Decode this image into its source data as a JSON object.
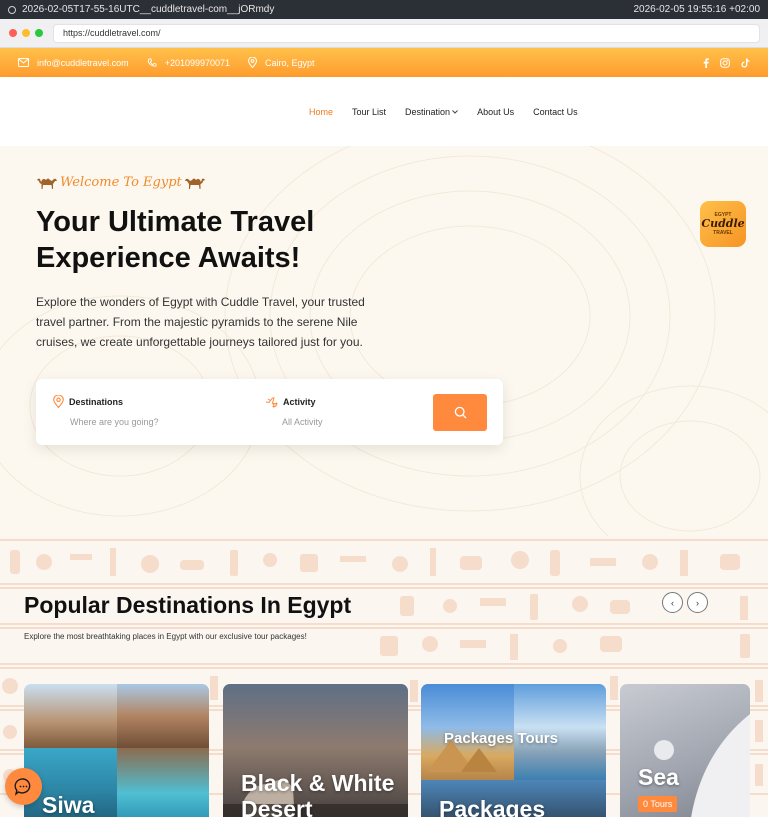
{
  "recording": {
    "filename": "2026-02-05T17-55-16UTC__cuddletravel-com__jORmdy",
    "timestamp": "2026-02-05 19:55:16 +02:00"
  },
  "browser": {
    "url": "https://cuddletravel.com/",
    "traffic_lights": [
      "#ff5f57",
      "#febc2e",
      "#28c840"
    ]
  },
  "topbar": {
    "email": "info@cuddletravel.com",
    "phone": "+201099970071",
    "location": "Cairo, Egypt",
    "socials": [
      "facebook-icon",
      "instagram-icon",
      "tiktok-icon"
    ]
  },
  "nav": {
    "items": [
      {
        "label": "Home",
        "active": true
      },
      {
        "label": "Tour List",
        "active": false
      },
      {
        "label": "Destination",
        "active": false,
        "dropdown": true
      },
      {
        "label": "About Us",
        "active": false
      },
      {
        "label": "Contact Us",
        "active": false
      }
    ]
  },
  "hero": {
    "welcome": "Welcome To Egypt",
    "title": "Your Ultimate Travel Experience Awaits!",
    "description": "Explore the wonders of Egypt with Cuddle Travel, your trusted travel partner. From the majestic pyramids to the serene Nile cruises, we create unforgettable journeys tailored just for you.",
    "search": {
      "destinations_label": "Destinations",
      "destinations_placeholder": "Where are you going?",
      "activity_label": "Activity",
      "activity_placeholder": "All Activity"
    },
    "badge": {
      "line1": "EGYPT",
      "line2": "Cuddle",
      "line3": "TRAVEL"
    }
  },
  "popular": {
    "title": "Popular Destinations In Egypt",
    "subtitle": "Explore the most breathtaking places in Egypt with our exclusive tour packages!",
    "prev_label": "‹",
    "next_label": "›",
    "cards": [
      {
        "title": "Siwa",
        "overlay": ""
      },
      {
        "title": "Black & White Desert",
        "overlay": ""
      },
      {
        "title": "Packages",
        "overlay": "Packages Tours"
      },
      {
        "title": "Sea",
        "overlay": "",
        "tours": "0 Tours"
      }
    ]
  },
  "colors": {
    "accent": "#ff8a3d",
    "active_link": "#ee7b22",
    "topbar_top": "#ffc04a",
    "topbar_bottom": "#ff9c2e"
  }
}
